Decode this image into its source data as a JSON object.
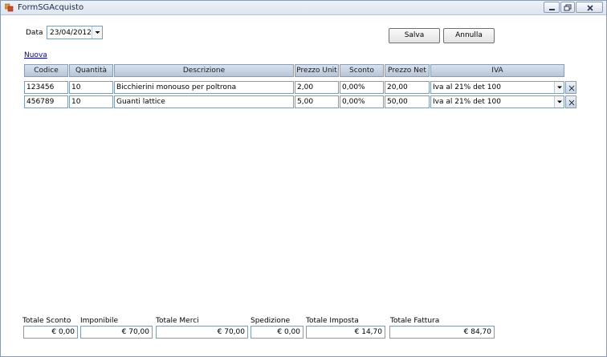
{
  "window": {
    "title": "FormSGAcquisto"
  },
  "form": {
    "date_label": "Data",
    "date_value": "23/04/2012",
    "save_label": "Salva",
    "cancel_label": "Annulla",
    "new_link": "Nuova"
  },
  "table": {
    "headers": [
      "Codice",
      "Quantità",
      "Descrizione",
      "Prezzo Unit",
      "Sconto",
      "Prezzo Net",
      "IVA"
    ],
    "rows": [
      {
        "codice": "123456",
        "quantita": "10",
        "descrizione": "Bicchierini monouso per poltrona",
        "prezzo_unit": "2,00",
        "sconto": "0,00%",
        "prezzo_net": "20,00",
        "iva": "Iva al 21% det 100"
      },
      {
        "codice": "456789",
        "quantita": "10",
        "descrizione": "Guanti lattice",
        "prezzo_unit": "5,00",
        "sconto": "0,00%",
        "prezzo_net": "50,00",
        "iva": "Iva al 21% det 100"
      }
    ],
    "delete_glyph": "X"
  },
  "totals": {
    "sconto": {
      "label": "Totale Sconto",
      "value": "€ 0,00"
    },
    "imponibile": {
      "label": "Imponibile",
      "value": "€ 70,00"
    },
    "merci": {
      "label": "Totale Merci",
      "value": "€ 70,00"
    },
    "spedizione": {
      "label": "Spedizione",
      "value": "€ 0,00"
    },
    "imposta": {
      "label": "Totale Imposta",
      "value": "€ 14,70"
    },
    "fattura": {
      "label": "Totale Fattura",
      "value": "€ 84,70"
    }
  },
  "icons": {
    "app": "form-window-icon",
    "minimize": "minimize-icon",
    "maximize": "maximize-icon",
    "close": "close-icon",
    "dropdown": "chevron-down-icon",
    "delete": "delete-x-icon"
  }
}
